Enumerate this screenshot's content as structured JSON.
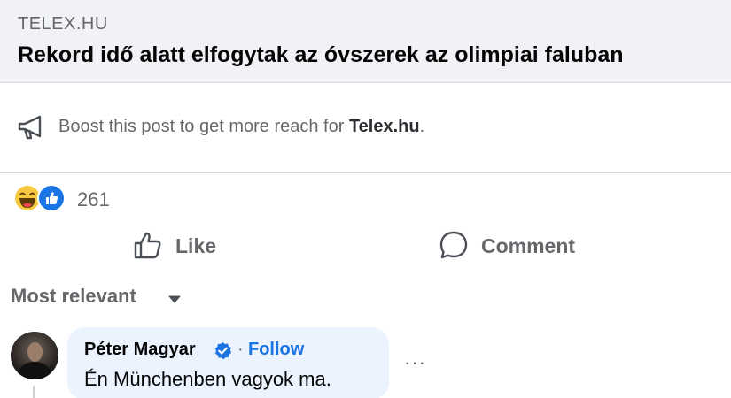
{
  "link_preview": {
    "domain": "TELEX.HU",
    "title": "Rekord idő alatt elfogytak az óvszerek az olimpiai faluban"
  },
  "boost": {
    "icon": "megaphone-icon",
    "text_prefix": "Boost this post to get more reach for ",
    "page_name": "Telex.hu",
    "text_suffix": "."
  },
  "reactions": {
    "icons": [
      "haha-reaction-icon",
      "like-reaction-icon"
    ],
    "count": "261"
  },
  "actions": {
    "like_label": "Like",
    "comment_label": "Comment"
  },
  "comments_sort": {
    "label": "Most relevant"
  },
  "comment": {
    "author": "Péter Magyar",
    "separator": "·",
    "follow_label": "Follow",
    "text": "Én Münchenben vagyok ma.",
    "more_label": "···"
  },
  "colors": {
    "secondary_text": "#65676b",
    "link_blue": "#1b74e4",
    "preview_bg": "#f0f2f5",
    "comment_bubble_bg": "#eaf3fe"
  }
}
